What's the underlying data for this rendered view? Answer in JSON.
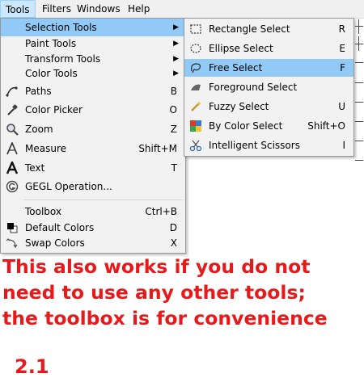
{
  "menubar": {
    "items": [
      {
        "label": "Tools",
        "active": true
      },
      {
        "label": "Filters"
      },
      {
        "label": "Windows"
      },
      {
        "label": "Help"
      }
    ]
  },
  "tools_menu": {
    "items": [
      {
        "label": "Selection Tools",
        "submenu": true,
        "highlighted": true
      },
      {
        "label": "Paint Tools",
        "submenu": true
      },
      {
        "label": "Transform Tools",
        "submenu": true
      },
      {
        "label": "Color Tools",
        "submenu": true
      },
      {
        "label": "Paths",
        "shortcut": "B",
        "icon": "paths-icon"
      },
      {
        "label": "Color Picker",
        "shortcut": "O",
        "icon": "color-picker-icon"
      },
      {
        "label": "Zoom",
        "shortcut": "Z",
        "icon": "zoom-icon"
      },
      {
        "label": "Measure",
        "shortcut": "Shift+M",
        "icon": "measure-icon"
      },
      {
        "label": "Text",
        "shortcut": "T",
        "icon": "text-icon"
      },
      {
        "label": "GEGL Operation...",
        "icon": "gegl-icon"
      },
      {
        "label": "Toolbox",
        "shortcut": "Ctrl+B"
      },
      {
        "label": "Default Colors",
        "shortcut": "D",
        "icon": "default-colors-icon"
      },
      {
        "label": "Swap Colors",
        "shortcut": "X",
        "icon": "swap-colors-icon"
      }
    ],
    "submenu_arrow": "▶"
  },
  "selection_submenu": {
    "items": [
      {
        "label": "Rectangle Select",
        "shortcut": "R",
        "icon": "rectangle-select-icon"
      },
      {
        "label": "Ellipse Select",
        "shortcut": "E",
        "icon": "ellipse-select-icon"
      },
      {
        "label": "Free Select",
        "shortcut": "F",
        "icon": "free-select-icon",
        "highlighted": true
      },
      {
        "label": "Foreground Select",
        "shortcut": "",
        "icon": "foreground-select-icon"
      },
      {
        "label": "Fuzzy Select",
        "shortcut": "U",
        "icon": "fuzzy-select-icon"
      },
      {
        "label": "By Color Select",
        "shortcut": "Shift+O",
        "icon": "by-color-select-icon"
      },
      {
        "label": "Intelligent Scissors",
        "shortcut": "I",
        "icon": "intelligent-scissors-icon"
      }
    ]
  },
  "note": {
    "lines": [
      "This also works if you do not",
      "need to use any other tools;",
      "the toolbox is for convenience"
    ],
    "version": "2.1",
    "color": "#e8191a"
  },
  "colors": {
    "menu_bg": "#f2f2f2",
    "highlight": "#91c9f7",
    "menubar_active": "#cce8ff"
  }
}
